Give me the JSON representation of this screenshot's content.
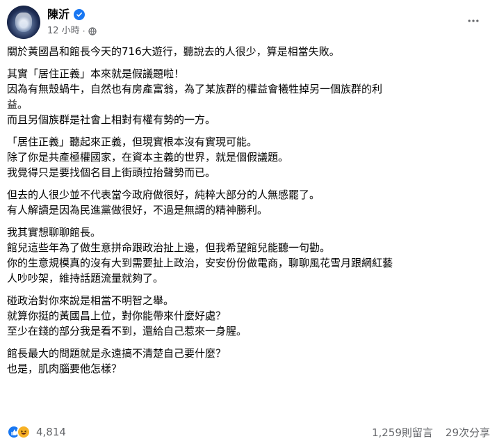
{
  "header": {
    "name": "陳沂",
    "time": "12 小時",
    "separator": "·"
  },
  "body": {
    "paragraphs": [
      [
        "關於黃國昌和館長今天的716大遊行，聽說去的人很少，算是相當失敗。"
      ],
      [
        "其實「居住正義」本來就是假議題啦！",
        "因為有無殼蝸牛，自然也有房產富翁，為了某族群的權益會犧牲掉另一個族群的利",
        "益。",
        "而且另個族群是社會上相對有權有勢的一方。"
      ],
      [
        "「居住正義」聽起來正義，但現實根本沒有實現可能。",
        "除了你是共產極權國家，在資本主義的世界，就是個假議題。",
        "我覺得只是要找個名目上街頭拉抬聲勢而已。"
      ],
      [
        "但去的人很少並不代表當今政府做很好，純粹大部分的人無感罷了。",
        "有人解讀是因為民進黨做很好，不過是無謂的精神勝利。"
      ],
      [
        "我其實想聊聊館長。",
        "館兒這些年為了做生意拼命跟政治扯上邊，但我希望館兒能聽一句勸。",
        "你的生意規模真的沒有大到需要扯上政治，安安份份做電商，聊聊風花雪月跟網紅藝",
        "人吵吵架，維持話題流量就夠了。"
      ],
      [
        "碰政治對你來說是相當不明智之舉。",
        "就算你挺的黃國昌上位，對你能帶來什麼好處？",
        "至少在錢的部分我是看不到，還給自己惹來一身腥。"
      ],
      [
        "館長最大的問題就是永遠搞不清楚自己要什麼？",
        "也是，肌肉腦要他怎樣？"
      ]
    ]
  },
  "footer": {
    "reaction_count": "4,814",
    "comments": "1,259則留言",
    "shares": "29次分享"
  },
  "icons": [
    "verified-icon",
    "globe-icon",
    "more-options-icon",
    "like-reaction-icon",
    "haha-reaction-icon"
  ],
  "colors": {
    "accent": "#1877f2",
    "muted": "#65676b",
    "text": "#050505"
  }
}
